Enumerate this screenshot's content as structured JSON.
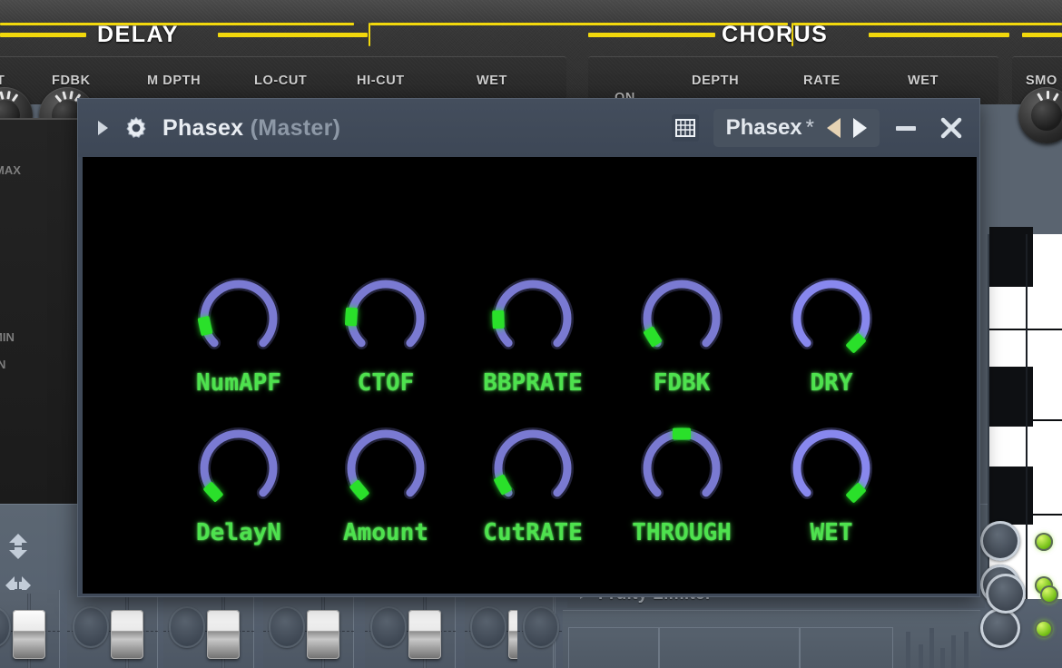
{
  "window": {
    "expand_icon": "triangle-right-icon",
    "gear_icon": "gear-icon",
    "title": "Phasex",
    "title_suffix": "(Master)",
    "grid_icon": "grid-keyboard-icon",
    "preset_name": "Phasex",
    "preset_modified_mark": "*",
    "prev_icon": "triangle-left-icon",
    "next_icon": "triangle-right-icon",
    "minimize_label": "minimize-icon",
    "close_label": "close-icon",
    "canvas_bg": "#000000"
  },
  "plugin": {
    "name": "Phasex",
    "knob_ring_color": "#7a7ad2",
    "knob_ring_color_bright": "#8888ee",
    "knob_marker_color": "#2ae02a",
    "label_color": "#4ee24e",
    "rows": [
      {
        "knobs": [
          {
            "label": "NumAPF",
            "value_pct": 12,
            "bright": false
          },
          {
            "label": "CTOF",
            "value_pct": 18,
            "bright": false
          },
          {
            "label": "BBPRATE",
            "value_pct": 16,
            "bright": false
          },
          {
            "label": "FDBK",
            "value_pct": 5,
            "bright": false
          },
          {
            "label": "DRY",
            "value_pct": 100,
            "bright": true
          }
        ]
      },
      {
        "knobs": [
          {
            "label": "DelayN",
            "value_pct": 1,
            "bright": false
          },
          {
            "label": "Amount",
            "value_pct": 2,
            "bright": false
          },
          {
            "label": "CutRATE",
            "value_pct": 6,
            "bright": false
          },
          {
            "label": "THROUGH",
            "value_pct": 50,
            "bright": false
          },
          {
            "label": "WET",
            "value_pct": 100,
            "bright": true
          }
        ]
      }
    ]
  },
  "host": {
    "accent_yellow": "#f2d80c",
    "sections": [
      {
        "name": "DELAY",
        "params": [
          "T",
          "FDBK",
          "M DPTH",
          "LO-CUT",
          "HI-CUT",
          "WET"
        ]
      },
      {
        "name": "CHORUS",
        "params": [
          "DEPTH",
          "RATE",
          "WET"
        ],
        "extra": "ON"
      },
      {
        "name": "",
        "params": [
          "SMO"
        ]
      }
    ],
    "graph_panel": {
      "max_label": "MAX",
      "min_label": "MIN",
      "extra_label": "N"
    },
    "mixer": {
      "updown_icon": "arrows-up-down-icon",
      "leftright_icon": "arrows-left-right-icon",
      "channel_count": 6
    },
    "effect_slot": {
      "arrow_icon": "triangle-right-icon",
      "name": "Fruity Limiter"
    }
  }
}
